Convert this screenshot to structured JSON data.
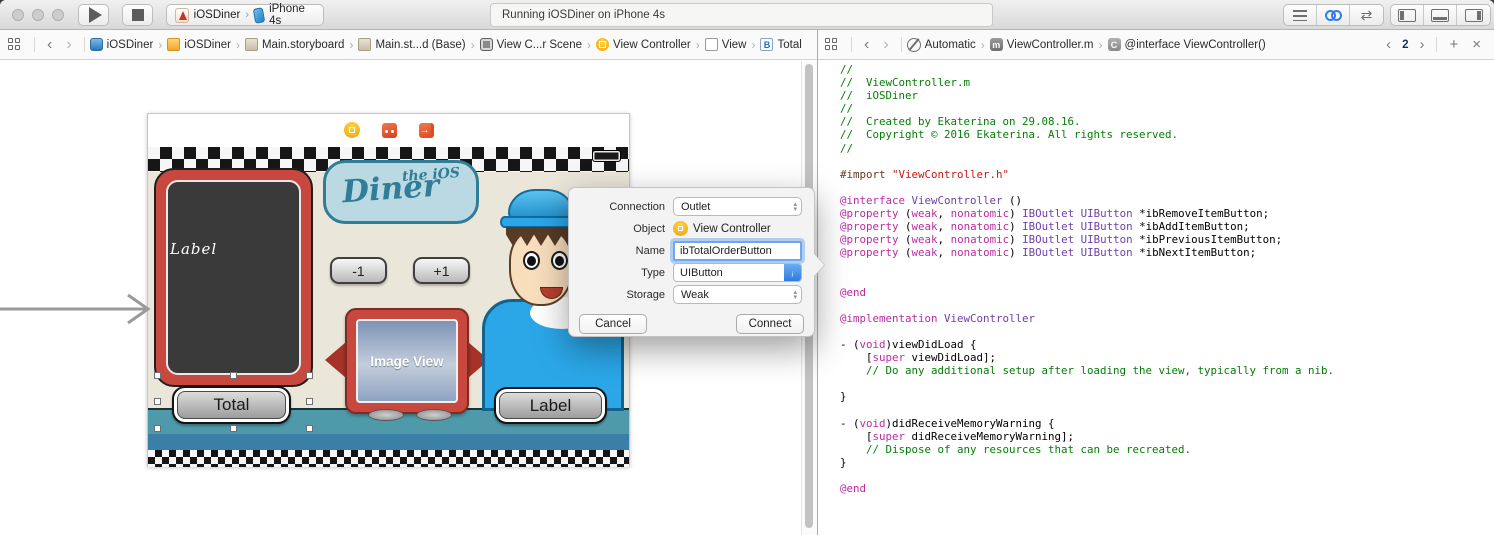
{
  "toolbar": {
    "status": "Running iOSDiner on iPhone 4s",
    "scheme_project": "iOSDiner",
    "scheme_device": "iPhone 4s",
    "scheme_separator": "›",
    "accent_blue": "#2f7fe8"
  },
  "icons": {
    "back": "‹",
    "forward": "›",
    "crumb_sep": "›",
    "plus": "+",
    "close": "×",
    "version_arrows": "⇄",
    "stepper_up": "▴",
    "stepper_down": "▾",
    "combo_chevron": "ⱼ",
    "exit_arrow": "→",
    "counter_left": "‹",
    "counter_right": "›"
  },
  "left_jumpbar": {
    "crumbs": [
      {
        "id": "project-iosdiner",
        "icon": "ic-project",
        "glyph": "",
        "label": "iOSDiner"
      },
      {
        "id": "folder-iosdiner",
        "icon": "ic-folder",
        "glyph": "",
        "label": "iOSDiner"
      },
      {
        "id": "main-storyboard",
        "icon": "ic-storyboard",
        "glyph": "",
        "label": "Main.storyboard"
      },
      {
        "id": "main-storyboard-base",
        "icon": "ic-storyboard",
        "glyph": "",
        "label": "Main.st...d (Base)"
      },
      {
        "id": "view-controller-scene",
        "icon": "ic-scene",
        "glyph": "",
        "label": "View C...r Scene"
      },
      {
        "id": "view-controller",
        "icon": "ic-vc",
        "glyph": "",
        "label": "View Controller"
      },
      {
        "id": "view",
        "icon": "ic-view",
        "glyph": "",
        "label": "View"
      },
      {
        "id": "total-button",
        "icon": "ic-button",
        "glyph": "B",
        "label": "Total"
      }
    ]
  },
  "right_jumpbar": {
    "crumbs": [
      {
        "id": "automatic",
        "icon": "ic-auto",
        "glyph": "",
        "label": "Automatic"
      },
      {
        "id": "viewcontroller-m",
        "icon": "ic-mfile",
        "glyph": "m",
        "label": "ViewController.m"
      },
      {
        "id": "interface-viewcontroller",
        "icon": "ic-cclass",
        "glyph": "C",
        "label": "@interface ViewController()"
      }
    ],
    "counter": "2"
  },
  "popover": {
    "rows": [
      {
        "label": "Connection",
        "value": "Outlet"
      },
      {
        "label": "Object",
        "value": "View Controller"
      },
      {
        "label": "Name",
        "value": "ibTotalOrderButton"
      },
      {
        "label": "Type",
        "value": "UIButton"
      },
      {
        "label": "Storage",
        "value": "Weak"
      }
    ],
    "cancel_label": "Cancel",
    "connect_label": "Connect"
  },
  "canvas": {
    "chalkboard_label": "Label",
    "logo_top": "the iOS",
    "logo_script": "Diner",
    "minus_button": "-1",
    "plus_button": "+1",
    "image_view_label": "Image View",
    "total_button": "Total",
    "right_label_button": "Label"
  },
  "code": {
    "lines": [
      [
        [
          "//",
          "cm"
        ]
      ],
      [
        [
          "//  ViewController.m",
          "cm"
        ]
      ],
      [
        [
          "//  iOSDiner",
          "cm"
        ]
      ],
      [
        [
          "//",
          "cm"
        ]
      ],
      [
        [
          "//  Created by Ekaterina on 29.08.16.",
          "cm"
        ]
      ],
      [
        [
          "//  Copyright © 2016 Ekaterina. All rights reserved.",
          "cm"
        ]
      ],
      [
        [
          "//",
          "cm"
        ]
      ],
      [],
      [
        [
          "#import ",
          "pp"
        ],
        [
          "\"ViewController.h\"",
          "str"
        ]
      ],
      [],
      [
        [
          "@interface ",
          "kw"
        ],
        [
          "ViewController",
          "cls"
        ],
        [
          " ()",
          "pl"
        ]
      ],
      [
        [
          "@property ",
          "kw"
        ],
        [
          "(",
          "pl"
        ],
        [
          "weak",
          "kw"
        ],
        [
          ", ",
          "pl"
        ],
        [
          "nonatomic",
          "kw"
        ],
        [
          ") ",
          "pl"
        ],
        [
          "IBOutlet",
          "cls"
        ],
        [
          " ",
          "pl"
        ],
        [
          "UIButton",
          "cls"
        ],
        [
          " *ibRemoveItemButton;",
          "pl"
        ]
      ],
      [
        [
          "@property ",
          "kw"
        ],
        [
          "(",
          "pl"
        ],
        [
          "weak",
          "kw"
        ],
        [
          ", ",
          "pl"
        ],
        [
          "nonatomic",
          "kw"
        ],
        [
          ") ",
          "pl"
        ],
        [
          "IBOutlet",
          "cls"
        ],
        [
          " ",
          "pl"
        ],
        [
          "UIButton",
          "cls"
        ],
        [
          " *ibAddItemButton;",
          "pl"
        ]
      ],
      [
        [
          "@property ",
          "kw"
        ],
        [
          "(",
          "pl"
        ],
        [
          "weak",
          "kw"
        ],
        [
          ", ",
          "pl"
        ],
        [
          "nonatomic",
          "kw"
        ],
        [
          ") ",
          "pl"
        ],
        [
          "IBOutlet",
          "cls"
        ],
        [
          " ",
          "pl"
        ],
        [
          "UIButton",
          "cls"
        ],
        [
          " *ibPreviousItemButton;",
          "pl"
        ]
      ],
      [
        [
          "@property ",
          "kw"
        ],
        [
          "(",
          "pl"
        ],
        [
          "weak",
          "kw"
        ],
        [
          ", ",
          "pl"
        ],
        [
          "nonatomic",
          "kw"
        ],
        [
          ") ",
          "pl"
        ],
        [
          "IBOutlet",
          "cls"
        ],
        [
          " ",
          "pl"
        ],
        [
          "UIButton",
          "cls"
        ],
        [
          " *ibNextItemButton;",
          "pl"
        ]
      ],
      [],
      [],
      [
        [
          "@end",
          "kw"
        ]
      ],
      [],
      [
        [
          "@implementation ",
          "kw"
        ],
        [
          "ViewController",
          "cls"
        ]
      ],
      [],
      [
        [
          "- (",
          "pl"
        ],
        [
          "void",
          "kw"
        ],
        [
          ")viewDidLoad {",
          "pl"
        ]
      ],
      [
        [
          "    [",
          "pl"
        ],
        [
          "super",
          "kw"
        ],
        [
          " viewDidLoad];",
          "pl"
        ]
      ],
      [
        [
          "    // Do any additional setup after loading the view, typically from a nib.",
          "cm"
        ]
      ],
      [],
      [
        [
          "}",
          "pl"
        ]
      ],
      [],
      [
        [
          "- (",
          "pl"
        ],
        [
          "void",
          "kw"
        ],
        [
          ")didReceiveMemoryWarning {",
          "pl"
        ]
      ],
      [
        [
          "    [",
          "pl"
        ],
        [
          "super",
          "kw"
        ],
        [
          " didReceiveMemoryWarning];",
          "pl"
        ]
      ],
      [
        [
          "    // Dispose of any resources that can be recreated.",
          "cm"
        ]
      ],
      [
        [
          "}",
          "pl"
        ]
      ],
      [],
      [
        [
          "@end",
          "kw"
        ]
      ]
    ]
  }
}
